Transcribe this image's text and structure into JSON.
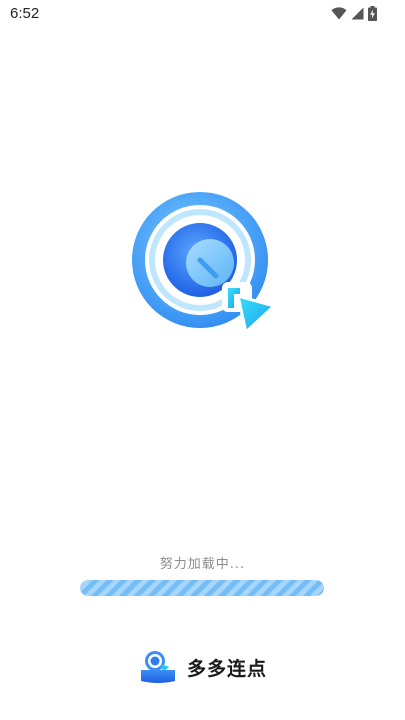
{
  "status_bar": {
    "time": "6:52",
    "icons": [
      "wifi-icon",
      "signal-icon",
      "battery-charging-icon"
    ]
  },
  "splash": {
    "logo_icon": "duoduo-clicker-logo",
    "loading_text": "努力加载中...",
    "progress_fraction": 1.0
  },
  "brand": {
    "icon": "duoduo-clicker-logo-small",
    "icon_text": "多多连点",
    "name": "多多连点"
  },
  "colors": {
    "accent": "#3b8ff5",
    "progress_track": "#d9ecfd",
    "progress_fill": "#74bdf7",
    "text_muted": "#8c8c8c"
  }
}
